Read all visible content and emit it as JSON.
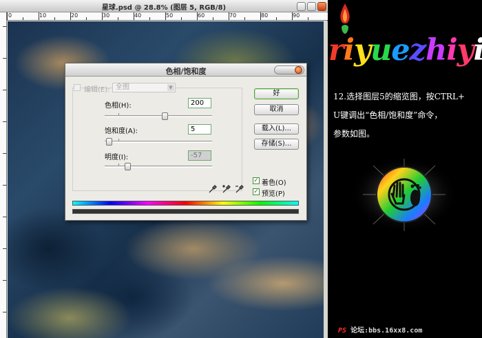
{
  "document": {
    "title": "星球.psd @ 28.8% (图层 5, RGB/8)",
    "ruler_numbers": [
      "0",
      "10",
      "20",
      "30",
      "40",
      "50",
      "60",
      "70",
      "80",
      "90"
    ]
  },
  "dialog": {
    "title": "色相/饱和度",
    "edit_label": "编辑(E):",
    "edit_value": "全图",
    "hue_label": "色相(H):",
    "hue_value": "200",
    "saturation_label": "饱和度(A):",
    "saturation_value": "5",
    "lightness_label": "明度(I):",
    "lightness_value": "-57",
    "ok_label": "好",
    "cancel_label": "取消",
    "load_label": "载入(L)...",
    "save_label": "存储(S)...",
    "colorize_label": "着色(O)",
    "colorize_checked": true,
    "preview_label": "预览(P)",
    "preview_checked": true
  },
  "brand": {
    "text": "riyuezhiyi",
    "colors": [
      "#f23a2a",
      "#ff7a1a",
      "#ffe01a",
      "#2ad84a",
      "#1a9cff",
      "#5a4cff",
      "#c83cff",
      "#ff3ab0",
      "#ff3a6a",
      "#ffffff"
    ]
  },
  "instructions": {
    "line1": "12.选择图层5的缩览图，按CTRL+",
    "line2": "U键调出“色相/饱和度”命令，",
    "line3": "参数如图。"
  },
  "footer": {
    "ps": "PS",
    "text": "论坛:bbs.16xx8.com"
  }
}
